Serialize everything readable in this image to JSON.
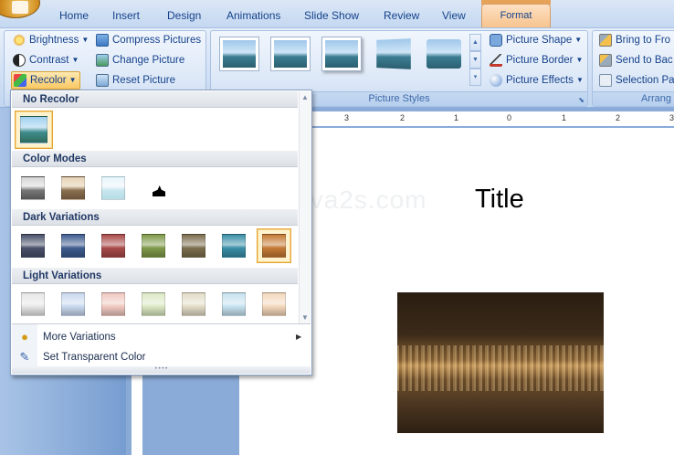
{
  "tabs": [
    "Home",
    "Insert",
    "Design",
    "Animations",
    "Slide Show",
    "Review",
    "View"
  ],
  "active_tab": "Format",
  "adjust": {
    "brightness": "Brightness",
    "contrast": "Contrast",
    "recolor": "Recolor",
    "compress": "Compress Pictures",
    "change": "Change Picture",
    "reset": "Reset Picture"
  },
  "picture_styles": {
    "group_label": "Picture Styles",
    "shape": "Picture Shape",
    "border": "Picture Border",
    "effects": "Picture Effects"
  },
  "arrange": {
    "bring": "Bring to Fro",
    "send": "Send to Bac",
    "selection": "Selection Pa",
    "group_label": "Arrang"
  },
  "ruler_labels": [
    "3",
    "2",
    "1",
    "0",
    "1",
    "2",
    "3"
  ],
  "slide": {
    "title": "Title",
    "watermark": "www.java2s.com"
  },
  "recolor_menu": {
    "sections": {
      "no_recolor": "No Recolor",
      "color_modes": "Color Modes",
      "dark": "Dark Variations",
      "light": "Light Variations"
    },
    "more_variations": "More Variations",
    "set_transparent": "Set Transparent Color",
    "dark_colors": [
      "#49506a",
      "#3e5c8f",
      "#a94a4a",
      "#7f9a4a",
      "#7c6e4e",
      "#3a8fa8",
      "#c57a34"
    ],
    "light_colors": [
      "#e6e6e6",
      "#c9d8ee",
      "#f0c8c0",
      "#dbe8c4",
      "#e2dcc7",
      "#c6e2ef",
      "#f3d7bb"
    ],
    "selected_dark_index": 6
  }
}
